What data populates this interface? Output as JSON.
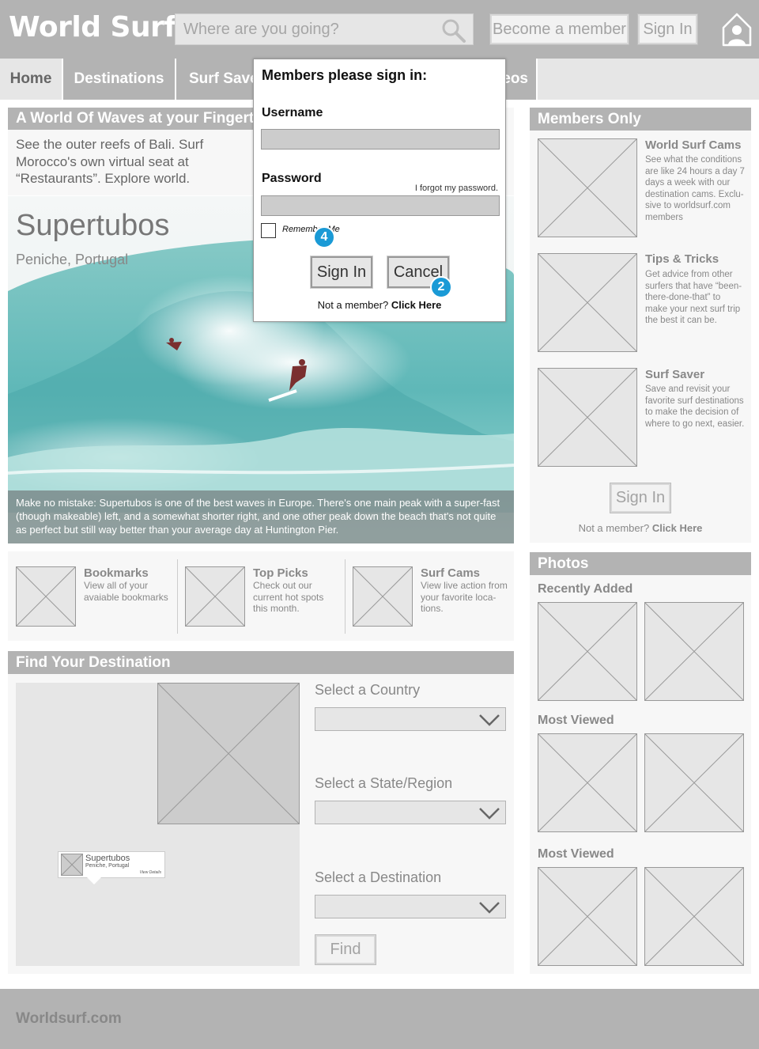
{
  "header": {
    "logo": "World Surf",
    "search_placeholder": "Where are you going?",
    "become_member_label": "Become a member",
    "sign_in_label": "Sign In"
  },
  "nav": {
    "items": [
      {
        "label": "Home"
      },
      {
        "label": "Destinations"
      },
      {
        "label": "Surf Saver"
      },
      {
        "label": "Videos"
      }
    ]
  },
  "main": {
    "intro_title": "A World Of Waves at your Fingertips",
    "intro_text": "See the outer reefs of Bali. Surf Morocco's own virtual seat at “Restaurants”. Explore world.",
    "hero": {
      "title": "Supertubos",
      "subtitle": "Peniche, Portugal",
      "caption": "Make no mistake: Supertubos is one of the best waves in Europe. There's one main peak with a super-fast (though makeable) left, and a somewhat shorter right, and one other peak down the beach that's not quite as perfect but still way better than your average day at Huntington Pier."
    },
    "quick_links": [
      {
        "title": "Bookmarks",
        "desc": "View all of your avaiable bookmarks"
      },
      {
        "title": "Top Picks",
        "desc": "Check out our current hot spots this month."
      },
      {
        "title": "Surf Cams",
        "desc": "View live action from your favorite loca- tions."
      }
    ],
    "find": {
      "title": "Find Your Destination",
      "country_label": "Select a Country",
      "state_label": "Select a State/Region",
      "destination_label": "Select a Destination",
      "find_label": "Find",
      "map_pin": {
        "name": "Supertubos",
        "place": "Peniche, Portugal",
        "link": "View Details"
      }
    }
  },
  "sidebar": {
    "members_title": "Members Only",
    "items": [
      {
        "title": "World Surf Cams",
        "desc": "See what the conditions are like 24 hours a day 7 days a week with our destination cams. Exclu- sive to worldsurf.com members"
      },
      {
        "title": "Tips & Tricks",
        "desc": "Get advice from other surfers that have “been-there-done-that” to make your next surf trip the best it can be."
      },
      {
        "title": "Surf Saver",
        "desc": "Save and revisit your favorite surf destinations to make the decision of where to go next, easier."
      }
    ],
    "sign_in_label": "Sign In",
    "not_member_text": "Not a member?",
    "click_here": "Click Here",
    "photos_title": "Photos",
    "recently_added": "Recently Added",
    "most_viewed_1": "Most Viewed",
    "most_viewed_2": "Most Viewed"
  },
  "modal": {
    "title": "Members please sign in:",
    "username_label": "Username",
    "password_label": "Password",
    "forgot": "I forgot my password.",
    "remember": "Remember Me",
    "sign_in_label": "Sign In",
    "cancel_label": "Cancel",
    "not_member_text": "Not a member?",
    "click_here": "Click Here",
    "badge_a": "4",
    "badge_b": "2",
    "badge_color": "#1a9ad6"
  },
  "footer": {
    "text": "Worldsurf.com"
  }
}
